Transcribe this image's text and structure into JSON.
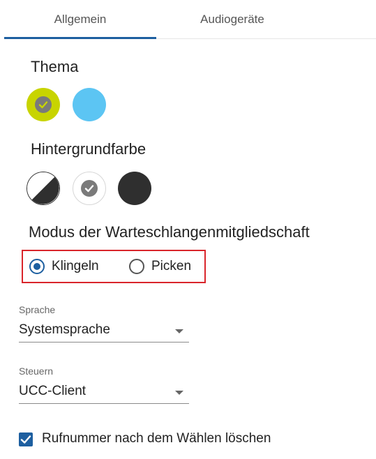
{
  "tabs": [
    {
      "label": "Allgemein",
      "active": true
    },
    {
      "label": "Audiogeräte",
      "active": false
    }
  ],
  "accent_color": "#1d5fa0",
  "theme": {
    "title": "Thema",
    "options": [
      {
        "name": "lime",
        "color": "#c8d400",
        "selected": true
      },
      {
        "name": "light-blue",
        "color": "#5cc5f3",
        "selected": false
      }
    ]
  },
  "background": {
    "title": "Hintergrundfarbe",
    "options": [
      {
        "name": "auto",
        "colors": [
          "#ffffff",
          "#2f2f2f"
        ],
        "selected": false
      },
      {
        "name": "light",
        "color": "#ffffff",
        "selected": true
      },
      {
        "name": "dark",
        "color": "#2f2f2f",
        "selected": false
      }
    ]
  },
  "queue_mode": {
    "title": "Modus der Warteschlangenmitgliedschaft",
    "options": [
      {
        "label": "Klingeln",
        "checked": true
      },
      {
        "label": "Picken",
        "checked": false
      }
    ],
    "highlight_color": "#d9252b"
  },
  "language": {
    "label": "Sprache",
    "value": "Systemsprache"
  },
  "control": {
    "label": "Steuern",
    "value": "UCC-Client"
  },
  "clear_number": {
    "label": "Rufnummer nach dem Wählen löschen",
    "checked": true
  }
}
